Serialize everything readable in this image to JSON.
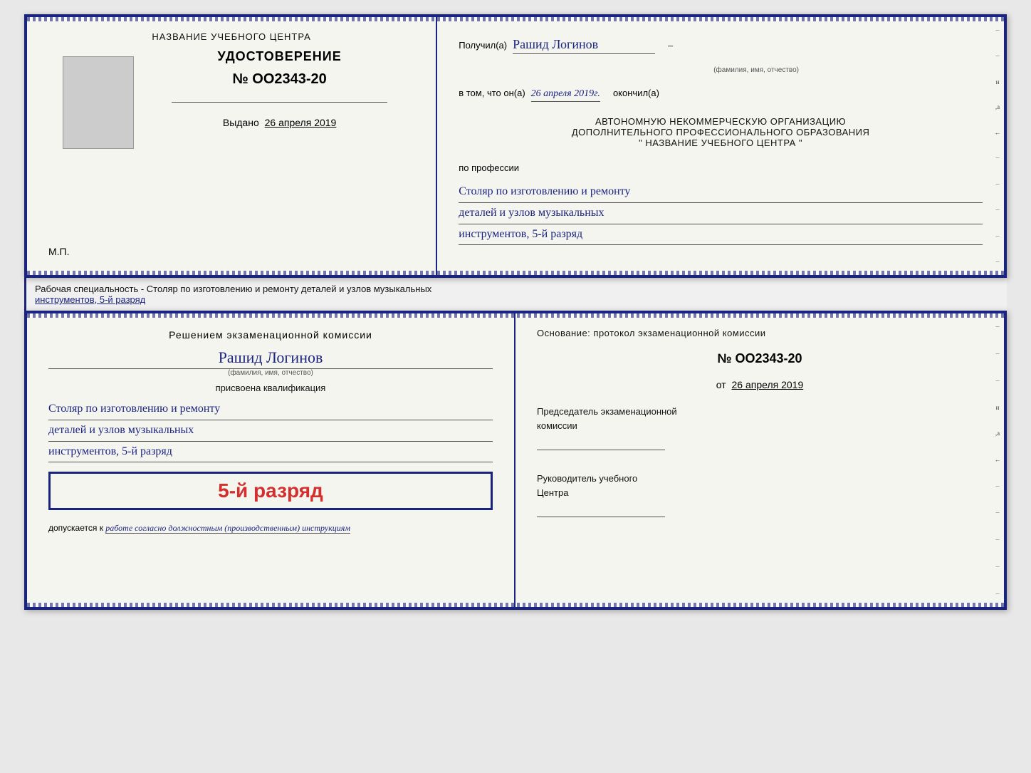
{
  "top_doc": {
    "left": {
      "title": "НАЗВАНИЕ УЧЕБНОГО ЦЕНТРА",
      "udostoverenie_label": "УДОСТОВЕРЕНИЕ",
      "number": "№ OO2343-20",
      "vydano_label": "Выдано",
      "vydano_date": "26 апреля 2019",
      "mp_label": "М.П."
    },
    "right": {
      "poluchil_label": "Получил(а)",
      "recipient_name": "Рашид Логинов",
      "name_subtext": "(фамилия, имя, отчество)",
      "vtom_label": "в том, что он(а)",
      "date_italic": "26 апреля 2019г.",
      "okончил_label": "окончил(а)",
      "org_line1": "АВТОНОМНУЮ НЕКОММЕРЧЕСКУЮ ОРГАНИЗАЦИЮ",
      "org_line2": "ДОПОЛНИТЕЛЬНОГО ПРОФЕССИОНАЛЬНОГО ОБРАЗОВАНИЯ",
      "org_line3": "\"  НАЗВАНИЕ УЧЕБНОГО ЦЕНТРА  \"",
      "po_professii": "по профессии",
      "profession_line1": "Столяр по изготовлению и ремонту",
      "profession_line2": "деталей и узлов музыкальных",
      "profession_line3": "инструментов, 5-й разряд"
    }
  },
  "specialty_label": {
    "prefix": "Рабочая специальность - Столяр по изготовлению и ремонту деталей и узлов музыкальных",
    "underlined": "инструментов, 5-й разряд"
  },
  "bottom_doc": {
    "left": {
      "title_line1": "Решением экзаменационной комиссии",
      "recipient_name": "Рашид Логинов",
      "name_subtext": "(фамилия, имя, отчество)",
      "prisvoena": "присвоена квалификация",
      "qualification_line1": "Столяр по изготовлению и ремонту",
      "qualification_line2": "деталей и узлов музыкальных",
      "qualification_line3": "инструментов, 5-й разряд",
      "rank_text": "5-й разряд",
      "dopuskaetsya_label": "допускается к",
      "dopuskaetsya_value": "работе согласно должностным (производственным) инструкциям"
    },
    "right": {
      "osnovaniye_label": "Основание: протокол экзаменационной комиссии",
      "protocol_number": "№  OO2343-20",
      "protocol_date_label": "от",
      "protocol_date": "26 апреля 2019",
      "predsedatel_line1": "Председатель экзаменационной",
      "predsedatel_line2": "комиссии",
      "rukovoditel_line1": "Руководитель учебного",
      "rukovoditel_line2": "Центра"
    }
  }
}
